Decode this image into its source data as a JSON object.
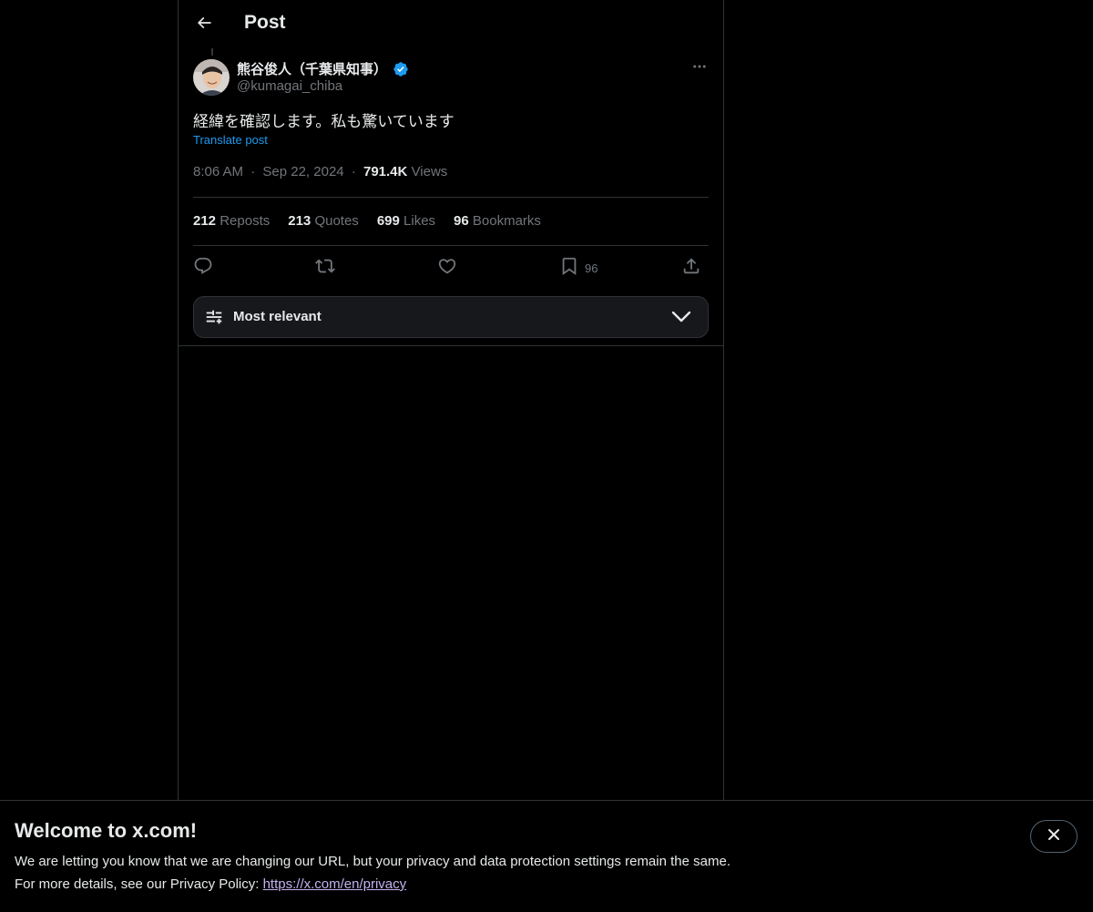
{
  "header": {
    "title": "Post"
  },
  "post": {
    "author_name": "熊谷俊人（千葉県知事）",
    "author_handle": "@kumagai_chiba",
    "text": "経緯を確認します。私も驚いています",
    "translate_label": "Translate post",
    "time": "8:06 AM",
    "date": "Sep 22, 2024",
    "views_count": "791.4K",
    "views_label": "Views",
    "separator": "·"
  },
  "stats": {
    "reposts_count": "212",
    "reposts_label": "Reposts",
    "quotes_count": "213",
    "quotes_label": "Quotes",
    "likes_count": "699",
    "likes_label": "Likes",
    "bookmarks_count": "96",
    "bookmarks_label": "Bookmarks"
  },
  "actions": {
    "bookmark_count": "96"
  },
  "sort": {
    "label": "Most relevant"
  },
  "banner": {
    "title": "Welcome to x.com!",
    "line1": "We are letting you know that we are changing our URL, but your privacy and data protection settings remain the same.",
    "line2_prefix": "For more details, see our Privacy Policy: ",
    "link_text": "https://x.com/en/privacy"
  },
  "colors": {
    "background": "#000000",
    "text_primary": "#e7e9ea",
    "text_secondary": "#71767b",
    "accent_blue": "#1d9bf0",
    "border": "#2f3336",
    "link_visited": "#c2b2f0"
  },
  "icons": [
    "back-arrow-icon",
    "verified-badge-icon",
    "more-icon",
    "reply-icon",
    "repost-icon",
    "like-icon",
    "bookmark-icon",
    "share-icon",
    "sort-sliders-icon",
    "chevron-down-icon",
    "close-icon"
  ]
}
